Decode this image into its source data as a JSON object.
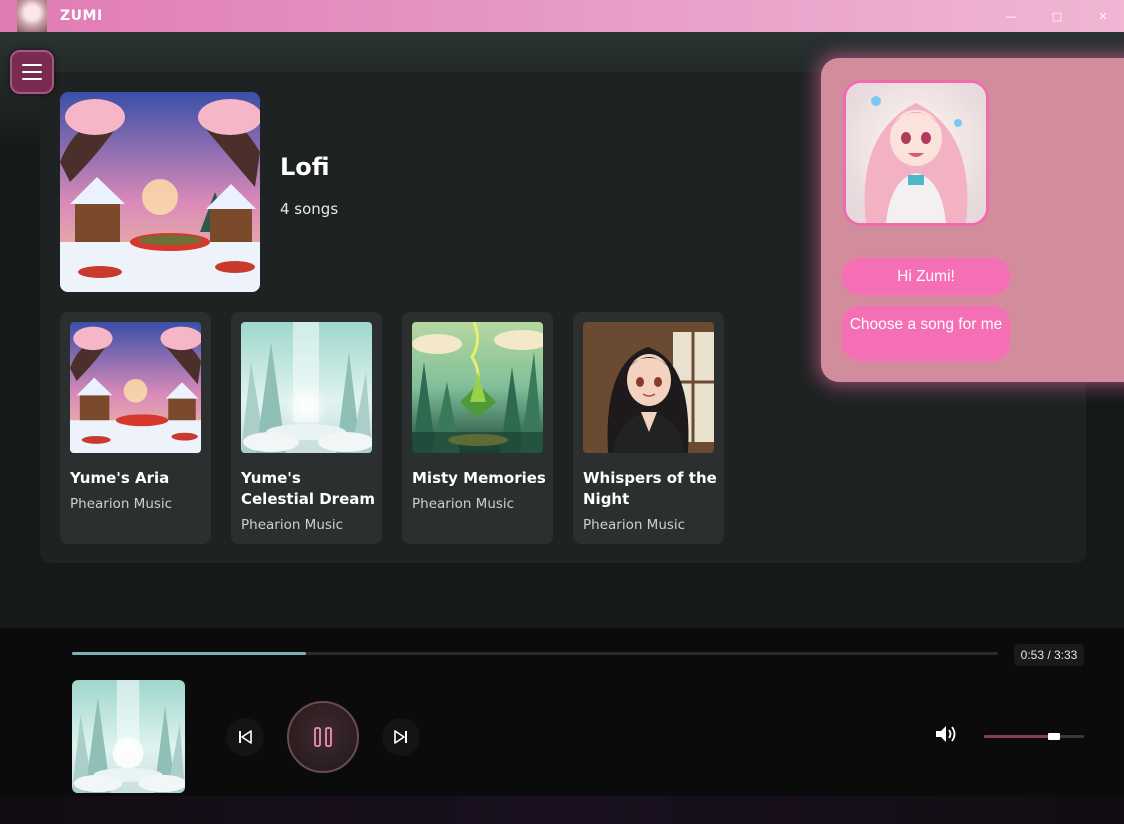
{
  "window": {
    "title": "ZUMI",
    "minimize": "—",
    "maximize": "□",
    "close": "✕"
  },
  "playlist": {
    "title": "Lofi",
    "count": "4 songs"
  },
  "songs": [
    {
      "title": "Yume's Aria",
      "artist": "Phearion Music",
      "art": "winter-cottage"
    },
    {
      "title": "Yume's Celestial Dream",
      "artist": "Phearion Music",
      "art": "crystal-ice"
    },
    {
      "title": "Misty Memories",
      "artist": "Phearion Music",
      "art": "green-forest"
    },
    {
      "title": "Whispers of the Night",
      "artist": "Phearion Music",
      "art": "anime-girl"
    }
  ],
  "zumi": {
    "greeting_button": "Hi Zumi!",
    "choose_button": "Choose a song for me"
  },
  "player": {
    "time": "0:53 / 3:33",
    "progress": 0.253,
    "volume": 0.7,
    "state": "playing"
  },
  "colors": {
    "accent_pink": "#f46fb4",
    "titlebar": "#e07bb4",
    "progress": "#7fb0b8"
  }
}
